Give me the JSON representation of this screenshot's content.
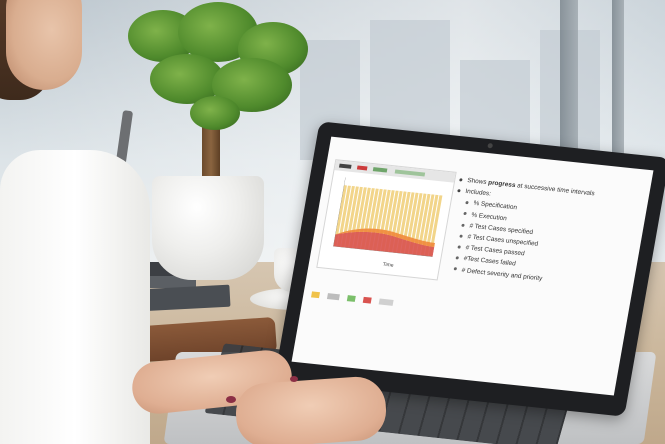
{
  "slide": {
    "bullets": [
      {
        "level": 1,
        "text_before": "Shows ",
        "bold": "progress",
        "text_after": " at successive time intervals"
      },
      {
        "level": 1,
        "text_before": "Includes:",
        "bold": "",
        "text_after": ""
      },
      {
        "level": 2,
        "text_before": "% Specification",
        "bold": "",
        "text_after": ""
      },
      {
        "level": 2,
        "text_before": "% Execution",
        "bold": "",
        "text_after": ""
      },
      {
        "level": 2,
        "text_before": "# Test Cases specified",
        "bold": "",
        "text_after": ""
      },
      {
        "level": 2,
        "text_before": "# Test Cases unspecified",
        "bold": "",
        "text_after": ""
      },
      {
        "level": 2,
        "text_before": "# Test Cases passed",
        "bold": "",
        "text_after": ""
      },
      {
        "level": 2,
        "text_before": "#Test Cases failed",
        "bold": "",
        "text_after": ""
      },
      {
        "level": 2,
        "text_before": "# Defect severity and priority",
        "bold": "",
        "text_after": ""
      }
    ],
    "chart": {
      "xlabel": "Time"
    }
  },
  "colors": {
    "bar_fill": "#f2d58a",
    "bar_stripe": "#ffffff",
    "area_orange": "#f08a3a",
    "area_red": "#d9534f",
    "toolbar_green": "#6fa56a"
  }
}
